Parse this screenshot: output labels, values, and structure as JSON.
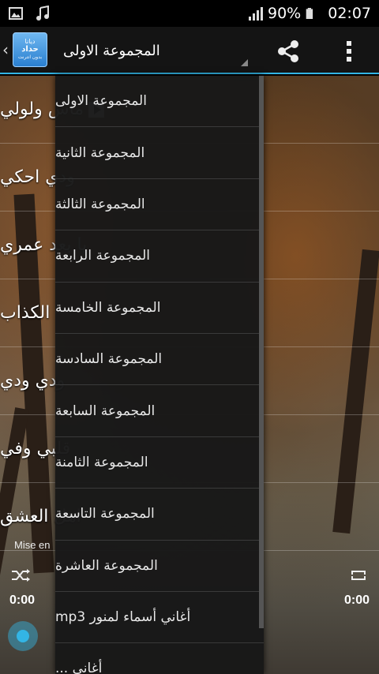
{
  "status_bar": {
    "battery": "90%",
    "time": "02:07",
    "icons": [
      "image-notification-icon",
      "music-notification-icon",
      "signal-icon",
      "battery-icon"
    ]
  },
  "action_bar": {
    "selected_group": "المجموعة الاولى",
    "logo_lines": [
      "ديانا",
      "حداد",
      "بدون انترنت"
    ]
  },
  "songs": [
    "ماس ولولي",
    "ودي احكي",
    "يا بعد عمري",
    "الكذاب",
    "ودي ودي",
    "قلبي وفي",
    "اهل العشق"
  ],
  "player": {
    "label": "Mise en",
    "elapsed": "0:00",
    "duration": "0:00"
  },
  "dropdown": {
    "items": [
      "المجموعة الاولى",
      "المجموعة الثانية",
      "المجموعة الثالثة",
      "المجموعة الرابعة",
      "المجموعة الخامسة",
      "المجموعة السادسة",
      "المجموعة السابعة",
      "المجموعة الثامنة",
      "المجموعة التاسعة",
      "المجموعة العاشرة",
      "أغاني أسماء لمنور mp3",
      "أغاني ..."
    ]
  },
  "colors": {
    "accent": "#33b5e5",
    "action_bar": "#141414",
    "dropdown_bg": "#181818"
  }
}
